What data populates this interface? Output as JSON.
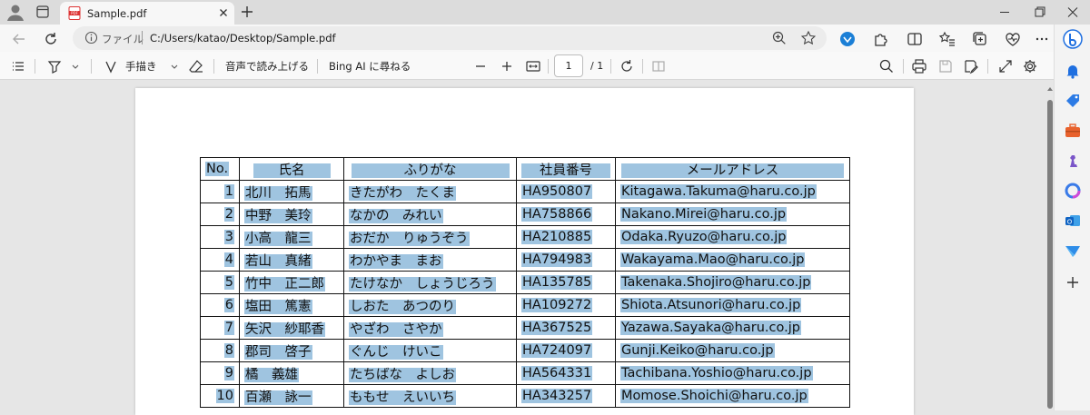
{
  "tab": {
    "title": "Sample.pdf",
    "favicon": "pdf-file-icon"
  },
  "address": {
    "scheme_label": "ファイル",
    "url": "C:/Users/katao/Desktop/Sample.pdf"
  },
  "pdf_toolbar": {
    "draw_label": "手描き",
    "read_aloud_label": "音声で読み上げる",
    "bing_label": "Bing AI に尋ねる",
    "page_current": "1",
    "page_total": "/ 1"
  },
  "table": {
    "headers": [
      "No.",
      "氏名",
      "ふりがな",
      "社員番号",
      "メールアドレス"
    ],
    "rows": [
      [
        "1",
        "北川　拓馬",
        "きたがわ　たくま",
        "HA950807",
        "Kitagawa.Takuma@haru.co.jp"
      ],
      [
        "2",
        "中野　美玲",
        "なかの　みれい",
        "HA758866",
        "Nakano.Mirei@haru.co.jp"
      ],
      [
        "3",
        "小高　龍三",
        "おだか　りゅうぞう",
        "HA210885",
        "Odaka.Ryuzo@haru.co.jp"
      ],
      [
        "4",
        "若山　真緒",
        "わかやま　まお",
        "HA794983",
        "Wakayama.Mao@haru.co.jp"
      ],
      [
        "5",
        "竹中　正二郎",
        "たけなか　しょうじろう",
        "HA135785",
        "Takenaka.Shojiro@haru.co.jp"
      ],
      [
        "6",
        "塩田　篤憲",
        "しおた　あつのり",
        "HA109272",
        "Shiota.Atsunori@haru.co.jp"
      ],
      [
        "7",
        "矢沢　紗耶香",
        "やざわ　さやか",
        "HA367525",
        "Yazawa.Sayaka@haru.co.jp"
      ],
      [
        "8",
        "郡司　啓子",
        "ぐんじ　けいこ",
        "HA724097",
        "Gunji.Keiko@haru.co.jp"
      ],
      [
        "9",
        "橘　義雄",
        "たちばな　よしお",
        "HA564331",
        "Tachibana.Yoshio@haru.co.jp"
      ],
      [
        "10",
        "百瀬　詠一",
        "ももせ　えいいち",
        "HA343257",
        "Momose.Shoichi@haru.co.jp"
      ]
    ]
  },
  "colors": {
    "selection": "#9fc4e0",
    "edge_blue": "#1f6fe0"
  }
}
